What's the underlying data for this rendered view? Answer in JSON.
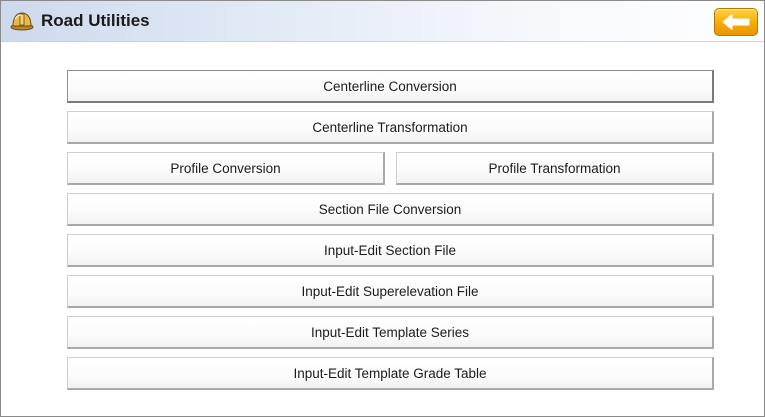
{
  "window": {
    "title": "Road Utilities",
    "title_icon": "hard-hat-icon",
    "back_icon": "left-arrow-icon",
    "back_color": "#f6ab00"
  },
  "menu": {
    "centerline_conversion": "Centerline Conversion",
    "centerline_transformation": "Centerline Transformation",
    "profile_conversion": "Profile Conversion",
    "profile_transformation": "Profile Transformation",
    "section_file_conversion": "Section File Conversion",
    "input_edit_section_file": "Input-Edit Section File",
    "input_edit_superelevation_file": "Input-Edit Superelevation File",
    "input_edit_template_series": "Input-Edit Template Series",
    "input_edit_template_grade_table": "Input-Edit Template Grade Table"
  }
}
